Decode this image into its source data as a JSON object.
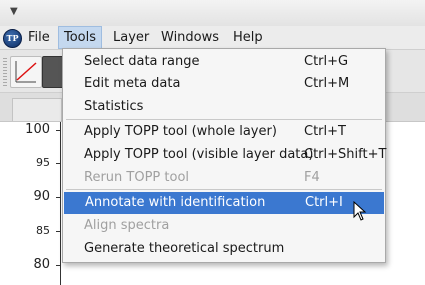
{
  "menubar": {
    "items": [
      {
        "label": "File",
        "active": false
      },
      {
        "label": "Tools",
        "active": true
      },
      {
        "label": "Layer",
        "active": false
      },
      {
        "label": "Windows",
        "active": false
      },
      {
        "label": "Help",
        "active": false
      }
    ]
  },
  "plot": {
    "y_ticks": [
      "100",
      "95",
      "90",
      "85",
      "80"
    ]
  },
  "tools_menu": {
    "items": [
      {
        "label": "Select data range",
        "shortcut": "Ctrl+G",
        "enabled": true
      },
      {
        "label": "Edit meta data",
        "shortcut": "Ctrl+M",
        "enabled": true
      },
      {
        "label": "Statistics",
        "shortcut": "",
        "enabled": true
      },
      {
        "label": "Apply TOPP tool (whole layer)",
        "shortcut": "Ctrl+T",
        "enabled": true
      },
      {
        "label": "Apply TOPP tool (visible layer data)",
        "shortcut": "Ctrl+Shift+T",
        "enabled": true
      },
      {
        "label": "Rerun TOPP tool",
        "shortcut": "F4",
        "enabled": false
      },
      {
        "label": "Annotate with identification",
        "shortcut": "Ctrl+I",
        "enabled": true,
        "highlighted": true
      },
      {
        "label": "Align spectra",
        "shortcut": "",
        "enabled": false
      },
      {
        "label": "Generate theoretical spectrum",
        "shortcut": "",
        "enabled": true
      }
    ]
  },
  "colors": {
    "highlight": "#3b78d0",
    "menubar_active": "#c4d8ef",
    "disabled_text": "#a0a0a0"
  }
}
